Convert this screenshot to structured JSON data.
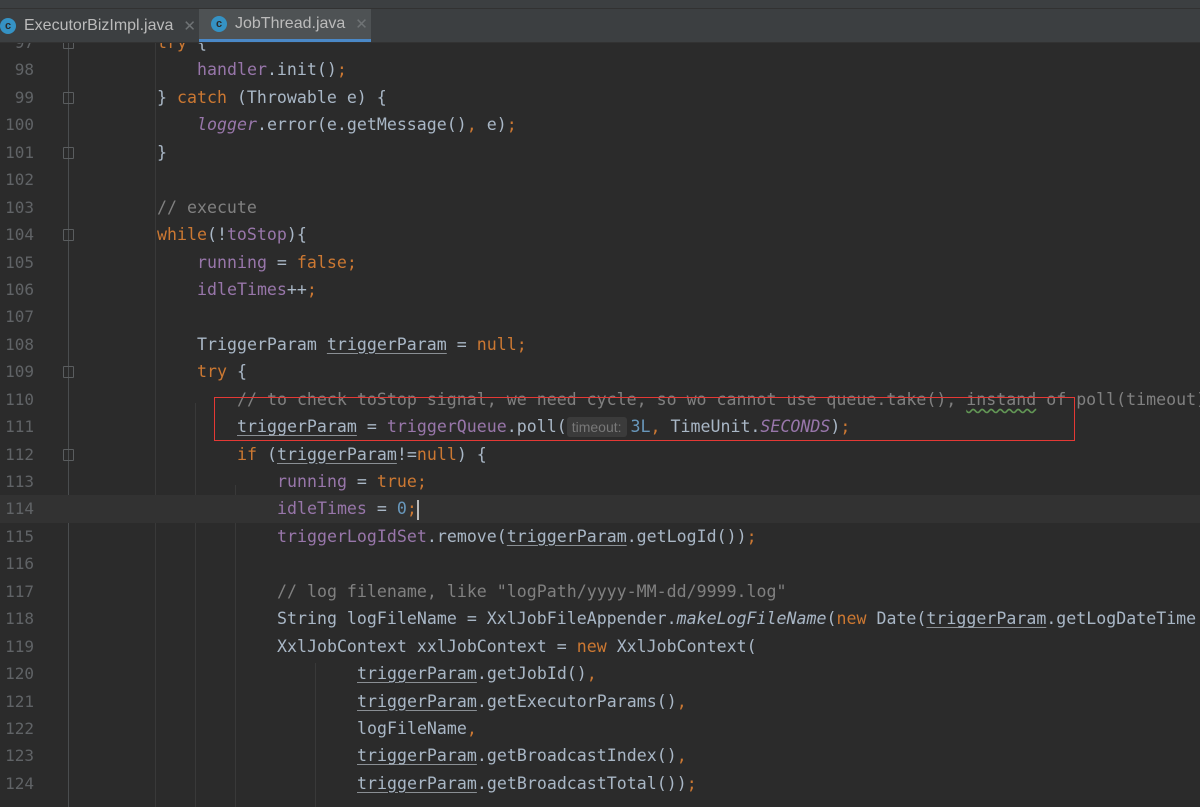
{
  "tabs": [
    {
      "label": "ExecutorBizImpl.java",
      "icon": "java-class-icon",
      "active": false
    },
    {
      "label": "JobThread.java",
      "icon": "java-class-icon",
      "active": true
    }
  ],
  "colors": {
    "accent": "#4a88c7",
    "highlight_box": "#e53935",
    "keyword": "#cc7832",
    "field": "#9876aa",
    "comment": "#808080",
    "number": "#6897bb"
  },
  "current_line": 114,
  "lines": [
    {
      "n": "97",
      "i": 2,
      "fold": true,
      "t": [
        [
          "try",
          "k"
        ],
        [
          " {",
          ""
        ]
      ]
    },
    {
      "n": "98",
      "i": 3,
      "t": [
        [
          "handler",
          "f"
        ],
        [
          ".init()",
          ""
        ],
        [
          ";",
          "k"
        ]
      ]
    },
    {
      "n": "99",
      "i": 2,
      "fold": true,
      "t": [
        [
          "} ",
          ""
        ],
        [
          "catch",
          "k"
        ],
        [
          " (Throwable e) {",
          ""
        ]
      ]
    },
    {
      "n": "100",
      "i": 3,
      "t": [
        [
          "logger",
          "fi"
        ],
        [
          ".error(e.getMessage()",
          ""
        ],
        [
          ",",
          "k"
        ],
        [
          " e)",
          ""
        ],
        [
          ";",
          "k"
        ]
      ]
    },
    {
      "n": "101",
      "i": 2,
      "fold": true,
      "t": [
        [
          "}",
          ""
        ]
      ]
    },
    {
      "n": "102",
      "i": 0,
      "t": []
    },
    {
      "n": "103",
      "i": 2,
      "t": [
        [
          "// execute",
          "c"
        ]
      ]
    },
    {
      "n": "104",
      "i": 2,
      "fold": true,
      "t": [
        [
          "while",
          "k"
        ],
        [
          "(!",
          ""
        ],
        [
          "toStop",
          "f"
        ],
        [
          "){",
          ""
        ]
      ]
    },
    {
      "n": "105",
      "i": 3,
      "t": [
        [
          "running",
          "f"
        ],
        [
          " = ",
          ""
        ],
        [
          "false",
          "k"
        ],
        [
          ";",
          "k"
        ]
      ]
    },
    {
      "n": "106",
      "i": 3,
      "t": [
        [
          "idleTimes",
          "f"
        ],
        [
          "++",
          ""
        ],
        [
          ";",
          "k"
        ]
      ]
    },
    {
      "n": "107",
      "i": 0,
      "t": []
    },
    {
      "n": "108",
      "i": 3,
      "t": [
        [
          "TriggerParam ",
          ""
        ],
        [
          "triggerParam",
          "u"
        ],
        [
          " = ",
          ""
        ],
        [
          "null",
          "k"
        ],
        [
          ";",
          "k"
        ]
      ]
    },
    {
      "n": "109",
      "i": 3,
      "fold": true,
      "t": [
        [
          "try",
          "k"
        ],
        [
          " {",
          ""
        ]
      ]
    },
    {
      "n": "110",
      "i": 4,
      "t": [
        [
          "// to check toStop signal, we need cycle, so wo cannot use queue.take(), ",
          "c"
        ],
        [
          "instand",
          "c w"
        ],
        [
          " of poll(timeout)",
          "c"
        ]
      ]
    },
    {
      "n": "111",
      "i": 4,
      "t": [
        [
          "triggerParam",
          "u"
        ],
        [
          " = ",
          ""
        ],
        [
          "triggerQueue",
          "f"
        ],
        [
          ".poll(",
          ""
        ],
        [
          "timeout:",
          "h"
        ],
        [
          "3L",
          "n"
        ],
        [
          ",",
          "k"
        ],
        [
          " TimeUnit.",
          ""
        ],
        [
          "SECONDS",
          "si"
        ],
        [
          ")",
          ""
        ],
        [
          ";",
          "k"
        ]
      ]
    },
    {
      "n": "112",
      "i": 4,
      "fold": true,
      "t": [
        [
          "if",
          "k"
        ],
        [
          " (",
          ""
        ],
        [
          "triggerParam",
          "u"
        ],
        [
          "!=",
          ""
        ],
        [
          "null",
          "k"
        ],
        [
          ") {",
          ""
        ]
      ]
    },
    {
      "n": "113",
      "i": 5,
      "t": [
        [
          "running",
          "f"
        ],
        [
          " = ",
          ""
        ],
        [
          "true",
          "k"
        ],
        [
          ";",
          "k"
        ]
      ]
    },
    {
      "n": "114",
      "i": 5,
      "t": [
        [
          "idleTimes",
          "f"
        ],
        [
          " = ",
          ""
        ],
        [
          "0",
          "n"
        ],
        [
          ";",
          "k"
        ],
        [
          "",
          "cursor"
        ]
      ]
    },
    {
      "n": "115",
      "i": 5,
      "t": [
        [
          "triggerLogIdSet",
          "f"
        ],
        [
          ".remove(",
          ""
        ],
        [
          "triggerParam",
          "u"
        ],
        [
          ".getLogId())",
          ""
        ],
        [
          ";",
          "k"
        ]
      ]
    },
    {
      "n": "116",
      "i": 0,
      "t": []
    },
    {
      "n": "117",
      "i": 5,
      "t": [
        [
          "// log filename, like \"logPath/yyyy-MM-dd/9999.log\"",
          "c"
        ]
      ]
    },
    {
      "n": "118",
      "i": 5,
      "t": [
        [
          "String logFileName = XxlJobFileAppender.",
          ""
        ],
        [
          "makeLogFileName",
          "mi"
        ],
        [
          "(",
          ""
        ],
        [
          "new",
          "k"
        ],
        [
          " Date(",
          ""
        ],
        [
          "triggerParam",
          "u"
        ],
        [
          ".getLogDateTime",
          ""
        ]
      ]
    },
    {
      "n": "119",
      "i": 5,
      "t": [
        [
          "XxlJobContext xxlJobContext = ",
          ""
        ],
        [
          "new",
          "k"
        ],
        [
          " XxlJobContext(",
          ""
        ]
      ]
    },
    {
      "n": "120",
      "i": 7,
      "t": [
        [
          "triggerParam",
          "u"
        ],
        [
          ".getJobId()",
          ""
        ],
        [
          ",",
          "k"
        ]
      ]
    },
    {
      "n": "121",
      "i": 7,
      "t": [
        [
          "triggerParam",
          "u"
        ],
        [
          ".getExecutorParams()",
          ""
        ],
        [
          ",",
          "k"
        ]
      ]
    },
    {
      "n": "122",
      "i": 7,
      "t": [
        [
          "logFileName",
          ""
        ],
        [
          ",",
          "k"
        ]
      ]
    },
    {
      "n": "123",
      "i": 7,
      "t": [
        [
          "triggerParam",
          "u"
        ],
        [
          ".getBroadcastIndex()",
          ""
        ],
        [
          ",",
          "k"
        ]
      ]
    },
    {
      "n": "124",
      "i": 7,
      "t": [
        [
          "triggerParam",
          "u"
        ],
        [
          ".getBroadcastTotal())",
          ""
        ],
        [
          ";",
          "k"
        ]
      ]
    }
  ]
}
